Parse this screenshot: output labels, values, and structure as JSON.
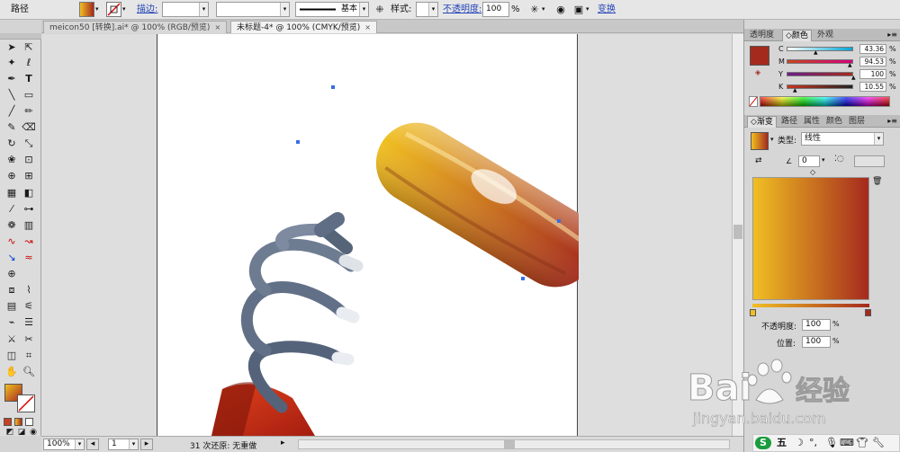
{
  "control_bar": {
    "selection_label": "路径",
    "stroke_label": "描边:",
    "stroke_weight": "",
    "brush_field": "",
    "stroke_profile": "基本",
    "style_label": "样式:",
    "opacity_label": "不透明度:",
    "opacity_value": "100",
    "opacity_unit": "%",
    "transform_label": "变换",
    "icon_names": [
      "fill-swatch-icon",
      "stroke-swatch-icon",
      "align-icon",
      "style-swatch-icon",
      "globe-icon",
      "document-setup-icon",
      "arrange-icon"
    ]
  },
  "document_tabs": [
    {
      "label": "meicon50 [转换].ai* @ 100% (RGB/预览)",
      "close": "×",
      "active": false
    },
    {
      "label": "未标题-4* @ 100% (CMYK/预览)",
      "close": "×",
      "active": true
    }
  ],
  "tools": {
    "icon_names": [
      "selection-tool-icon",
      "direct-selection-tool-icon",
      "magic-wand-icon",
      "lasso-icon",
      "pen-icon",
      "type-icon",
      "line-icon",
      "rectangle-icon",
      "paintbrush-icon",
      "pencil-icon",
      "blob-brush-icon",
      "eraser-icon",
      "rotate-icon",
      "scale-icon",
      "warp-icon",
      "free-transform-icon",
      "shape-builder-icon",
      "perspective-grid-icon",
      "mesh-icon",
      "gradient-icon",
      "eyedropper-icon",
      "blend-icon",
      "symbol-sprayer-icon",
      "column-graph-icon",
      "curvature-icon",
      "width-icon",
      "anchor-icon",
      "smooth-icon",
      "globe-tool-icon",
      "artboard-icon",
      "slice-icon",
      "hand-icon",
      "zoom-icon"
    ]
  },
  "status_bar": {
    "zoom": "100%",
    "page": "1",
    "history": "31 次还原: 无重做"
  },
  "color_panel": {
    "tabs": [
      "透明度",
      "颜色",
      "外观"
    ],
    "active_tab": "颜色",
    "current_color": "#a52a1e",
    "channels": [
      {
        "name": "C",
        "value": "43.36",
        "unit": "%",
        "color": "#00a6d6"
      },
      {
        "name": "M",
        "value": "94.53",
        "unit": "%",
        "color": "#d6007d"
      },
      {
        "name": "Y",
        "value": "100",
        "unit": "%",
        "color": "#e8d800"
      },
      {
        "name": "K",
        "value": "10.55",
        "unit": "%",
        "color": "#222222"
      }
    ]
  },
  "gradient_panel": {
    "tabs": [
      "渐变",
      "路径",
      "属性",
      "颜色",
      "图层"
    ],
    "active_tab": "渐变",
    "type_label": "类型:",
    "type_value": "线性",
    "angle_value": "0",
    "opacity_label": "不透明度:",
    "opacity_value": "100",
    "location_label": "位置:",
    "location_value": "100",
    "unit": "%",
    "start_color": "#f0bf22",
    "end_color": "#a52a1e"
  },
  "watermark": {
    "brand": "Bai",
    "brand_suffix": "经验",
    "url": "jingyan.baidu.com"
  },
  "taskbar": {
    "ime_label": "五"
  }
}
